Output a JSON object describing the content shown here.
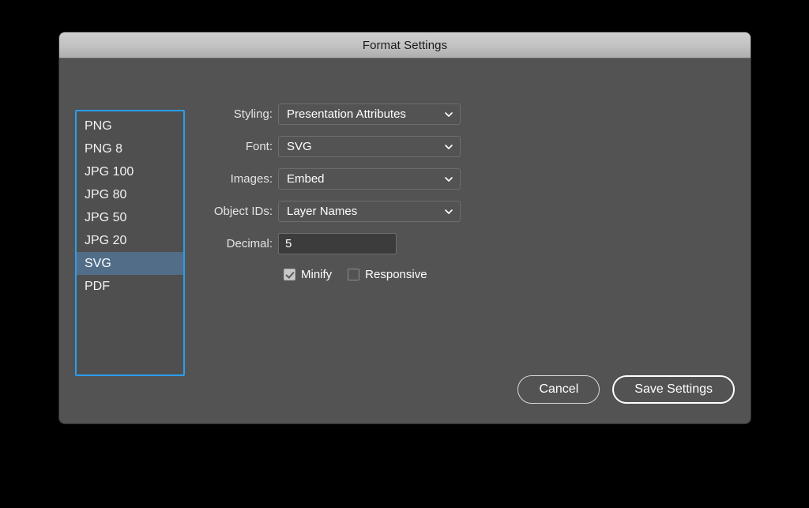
{
  "window": {
    "title": "Format Settings"
  },
  "format_list": {
    "items": [
      {
        "label": "PNG",
        "selected": false
      },
      {
        "label": "PNG 8",
        "selected": false
      },
      {
        "label": "JPG 100",
        "selected": false
      },
      {
        "label": "JPG 80",
        "selected": false
      },
      {
        "label": "JPG 50",
        "selected": false
      },
      {
        "label": "JPG 20",
        "selected": false
      },
      {
        "label": "SVG",
        "selected": true
      },
      {
        "label": "PDF",
        "selected": false
      }
    ],
    "selected_value": "SVG"
  },
  "form": {
    "styling": {
      "label": "Styling:",
      "value": "Presentation Attributes"
    },
    "font": {
      "label": "Font:",
      "value": "SVG"
    },
    "images": {
      "label": "Images:",
      "value": "Embed"
    },
    "object_ids": {
      "label": "Object IDs:",
      "value": "Layer Names"
    },
    "decimal": {
      "label": "Decimal:",
      "value": "5",
      "placeholder": "5"
    },
    "minify": {
      "label": "Minify",
      "checked": true
    },
    "responsive": {
      "label": "Responsive",
      "checked": false
    }
  },
  "footer": {
    "cancel_label": "Cancel",
    "save_label": "Save Settings"
  },
  "colors": {
    "dialog_bg": "#535353",
    "titlebar_top": "#cfcfcf",
    "selection_blue": "#516d88",
    "focus_ring": "#2a9ef0",
    "input_bg": "#3c3c3c",
    "text": "#ffffff"
  },
  "icons": {
    "chevron_down": "chevron-down-icon",
    "checkmark": "checkmark-icon"
  }
}
